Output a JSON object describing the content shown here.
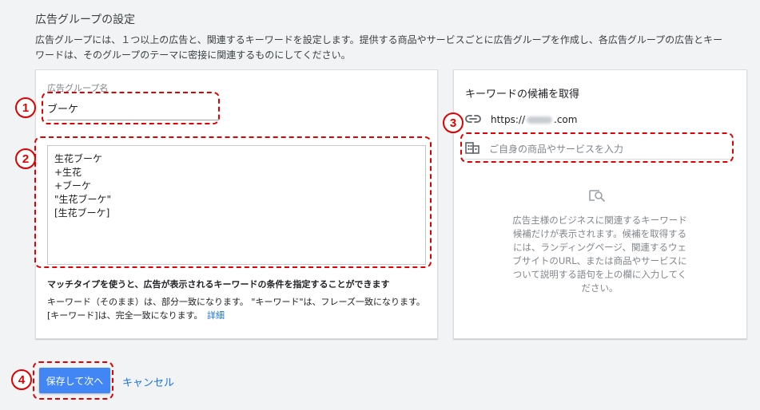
{
  "header": {
    "title": "広告グループの設定",
    "description": "広告グループには、１つ以上の広告と、関連するキーワードを設定します。提供する商品やサービスごとに広告グループを作成し、各広告グループの広告とキーワードは、そのグループのテーマに密接に関連するものにしてください。"
  },
  "ad_group": {
    "name_label": "広告グループ名",
    "name_value": "ブーケ"
  },
  "keywords": {
    "lines": [
      "生花ブーケ",
      "+生花",
      "+ブーケ",
      "\"生花ブーケ\"",
      "[生花ブーケ]"
    ]
  },
  "match_type": {
    "heading": "マッチタイプを使うと、広告が表示されるキーワードの条件を指定することができます",
    "line1": "キーワード（そのまま）は、部分一致になります。 \"キーワード\"は、フレーズ一致になります。",
    "line2": "[キーワード]は、完全一致になります。",
    "link": "詳細"
  },
  "suggestions": {
    "title": "キーワードの候補を取得",
    "url_prefix": "https://",
    "url_suffix": ".com",
    "product_placeholder": "ご自身の商品やサービスを入力",
    "info": "広告主様のビジネスに関連するキーワード候補だけが表示されます。候補を取得するには、ランディングページ、関連するウェブサイトのURL、または商品やサービスについて説明する語句を上の欄に入力してください。"
  },
  "buttons": {
    "save": "保存して次へ",
    "cancel": "キャンセル"
  },
  "annotations": [
    "1",
    "2",
    "3",
    "4"
  ],
  "colors": {
    "accent": "#4285f4",
    "link": "#1a73e8",
    "annotation": "#e00000"
  }
}
